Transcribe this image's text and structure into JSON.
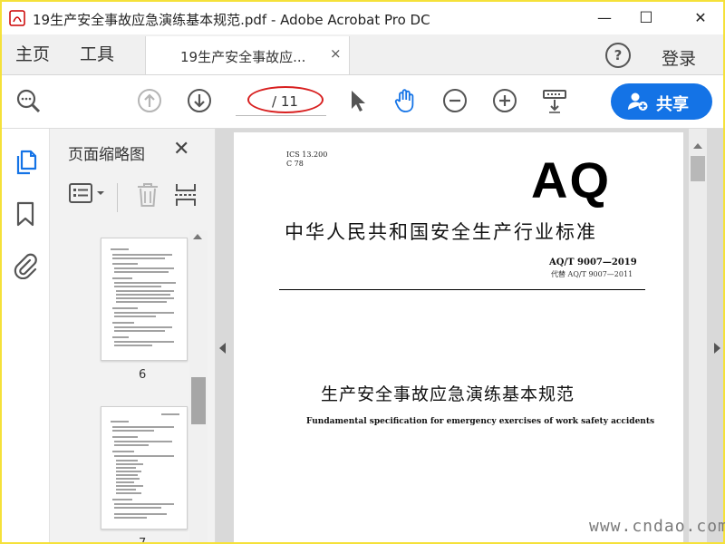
{
  "window": {
    "title": "19生产安全事故应急演练基本规范.pdf - Adobe Acrobat Pro DC",
    "minimize": "—",
    "maximize": "☐",
    "close": "✕"
  },
  "tabs": {
    "home": "主页",
    "tools": "工具",
    "document_tab": "19生产安全事故应...",
    "document_tab_close": "×",
    "help": "?",
    "login": "登录"
  },
  "toolbar": {
    "page_indicator": "/ 11",
    "share_label": "共享",
    "icons": [
      "search-zoom-icon",
      "page-up-icon",
      "page-down-icon",
      "select-pointer-icon",
      "hand-tool-icon",
      "zoom-out-icon",
      "zoom-in-icon",
      "scroll-mode-icon",
      "add-user-icon"
    ]
  },
  "panel": {
    "title": "页面缩略图",
    "close": "✕",
    "thumbnails": [
      {
        "page_label": "6"
      },
      {
        "page_label": "7"
      }
    ]
  },
  "document": {
    "ics": "ICS 13.200",
    "ccs": "C 78",
    "logo": "AQ",
    "header_title": "中华人民共和国安全生产行业标准",
    "std_number": "AQ/T 9007—2019",
    "replaces": "代替 AQ/T 9007—2011",
    "main_title_cn": "生产安全事故应急演练基本规范",
    "main_title_en": "Fundamental specification for emergency exercises of work safety accidents"
  },
  "watermark": {
    "text": "www.cndao.com"
  },
  "colors": {
    "accent": "#1473e6",
    "highlight_ellipse": "#d82020",
    "outer_border": "#f5e13a"
  }
}
